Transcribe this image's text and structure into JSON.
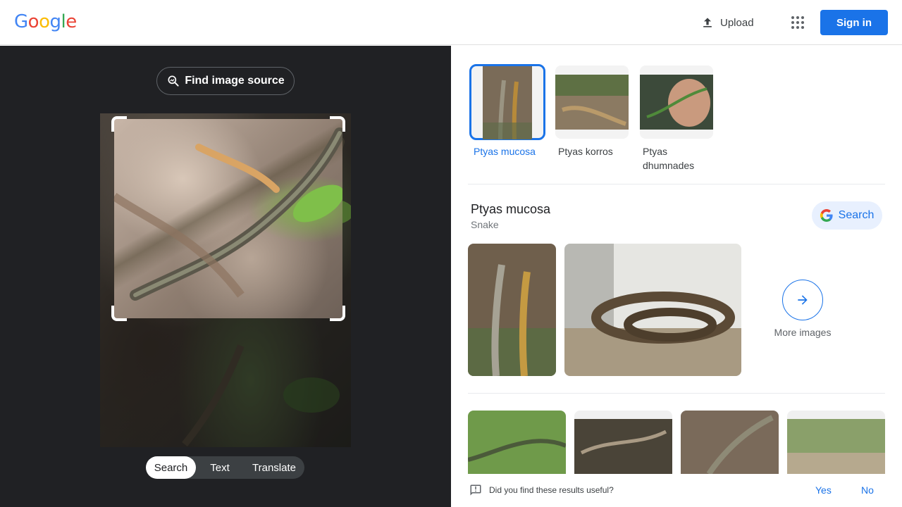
{
  "header": {
    "logo": [
      "G",
      "o",
      "o",
      "g",
      "l",
      "e"
    ],
    "upload_label": "Upload",
    "apps_icon": "apps-grid-icon",
    "signin_label": "Sign in"
  },
  "left": {
    "find_source_label": "Find image source",
    "tabs": [
      "Search",
      "Text",
      "Translate"
    ],
    "active_tab": "Search"
  },
  "results": {
    "thumbnails": [
      {
        "label": "Ptyas mucosa",
        "selected": true
      },
      {
        "label": "Ptyas korros",
        "selected": false
      },
      {
        "label": "Ptyas dhumnades",
        "selected": false
      }
    ],
    "entity": {
      "title": "Ptyas mucosa",
      "subtitle": "Snake",
      "search_label": "Search"
    },
    "more_images_label": "More images"
  },
  "feedback": {
    "question": "Did you find these results useful?",
    "yes": "Yes",
    "no": "No"
  },
  "colors": {
    "accent": "#1a73e8",
    "left_bg": "#202124"
  }
}
